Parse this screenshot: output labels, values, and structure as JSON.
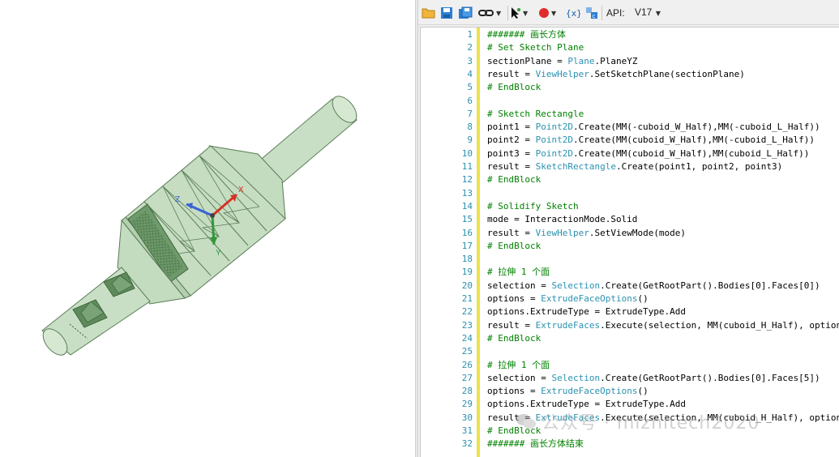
{
  "toolbar": {
    "items": [
      {
        "name": "open-folder"
      },
      {
        "name": "save"
      },
      {
        "name": "save-as"
      },
      {
        "name": "link"
      },
      {
        "name": "select-pointer"
      },
      {
        "name": "record"
      },
      {
        "name": "parameter"
      },
      {
        "name": "convert"
      }
    ],
    "api_label": "API:",
    "api_version": "V17"
  },
  "editor": {
    "lines": [
      {
        "n": "1",
        "segs": [
          {
            "t": "####### 画长方体",
            "c": "comment"
          }
        ]
      },
      {
        "n": "2",
        "segs": [
          {
            "t": "# Set Sketch Plane",
            "c": "comment"
          }
        ]
      },
      {
        "n": "3",
        "segs": [
          {
            "t": "sectionPlane = ",
            "c": "plain"
          },
          {
            "t": "Plane",
            "c": "class"
          },
          {
            "t": ".PlaneYZ",
            "c": "plain"
          }
        ]
      },
      {
        "n": "4",
        "segs": [
          {
            "t": "result = ",
            "c": "plain"
          },
          {
            "t": "ViewHelper",
            "c": "class"
          },
          {
            "t": ".SetSketchPlane(sectionPlane)",
            "c": "plain"
          }
        ]
      },
      {
        "n": "5",
        "segs": [
          {
            "t": "# EndBlock",
            "c": "comment"
          }
        ]
      },
      {
        "n": "6",
        "segs": []
      },
      {
        "n": "7",
        "segs": [
          {
            "t": "# Sketch Rectangle",
            "c": "comment"
          }
        ]
      },
      {
        "n": "8",
        "segs": [
          {
            "t": "point1 = ",
            "c": "plain"
          },
          {
            "t": "Point2D",
            "c": "class"
          },
          {
            "t": ".Create(MM(-cuboid_W_Half),MM(-cuboid_L_Half))",
            "c": "plain"
          }
        ]
      },
      {
        "n": "9",
        "segs": [
          {
            "t": "point2 = ",
            "c": "plain"
          },
          {
            "t": "Point2D",
            "c": "class"
          },
          {
            "t": ".Create(MM(cuboid_W_Half),MM(-cuboid_L_Half))",
            "c": "plain"
          }
        ]
      },
      {
        "n": "10",
        "segs": [
          {
            "t": "point3 = ",
            "c": "plain"
          },
          {
            "t": "Point2D",
            "c": "class"
          },
          {
            "t": ".Create(MM(cuboid_W_Half),MM(cuboid_L_Half))",
            "c": "plain"
          }
        ]
      },
      {
        "n": "11",
        "segs": [
          {
            "t": "result = ",
            "c": "plain"
          },
          {
            "t": "SketchRectangle",
            "c": "class"
          },
          {
            "t": ".Create(point1, point2, point3)",
            "c": "plain"
          }
        ]
      },
      {
        "n": "12",
        "segs": [
          {
            "t": "# EndBlock",
            "c": "comment"
          }
        ]
      },
      {
        "n": "13",
        "segs": []
      },
      {
        "n": "14",
        "segs": [
          {
            "t": "# Solidify Sketch",
            "c": "comment"
          }
        ]
      },
      {
        "n": "15",
        "segs": [
          {
            "t": "mode = InteractionMode.Solid",
            "c": "plain"
          }
        ]
      },
      {
        "n": "16",
        "segs": [
          {
            "t": "result = ",
            "c": "plain"
          },
          {
            "t": "ViewHelper",
            "c": "class"
          },
          {
            "t": ".SetViewMode(mode)",
            "c": "plain"
          }
        ]
      },
      {
        "n": "17",
        "segs": [
          {
            "t": "# EndBlock",
            "c": "comment"
          }
        ]
      },
      {
        "n": "18",
        "segs": []
      },
      {
        "n": "19",
        "segs": [
          {
            "t": "# 拉伸 1 个面",
            "c": "comment"
          }
        ]
      },
      {
        "n": "20",
        "segs": [
          {
            "t": "selection = ",
            "c": "plain"
          },
          {
            "t": "Selection",
            "c": "class"
          },
          {
            "t": ".Create(GetRootPart().Bodies[0].Faces[0])",
            "c": "plain"
          }
        ]
      },
      {
        "n": "21",
        "segs": [
          {
            "t": "options = ",
            "c": "plain"
          },
          {
            "t": "ExtrudeFaceOptions",
            "c": "class"
          },
          {
            "t": "()",
            "c": "plain"
          }
        ]
      },
      {
        "n": "22",
        "segs": [
          {
            "t": "options.ExtrudeType = ExtrudeType.Add",
            "c": "plain"
          }
        ]
      },
      {
        "n": "23",
        "segs": [
          {
            "t": "result = ",
            "c": "plain"
          },
          {
            "t": "ExtrudeFaces",
            "c": "class"
          },
          {
            "t": ".Execute(selection, MM(cuboid_H_Half), options)",
            "c": "plain"
          }
        ]
      },
      {
        "n": "24",
        "segs": [
          {
            "t": "# EndBlock",
            "c": "comment"
          }
        ]
      },
      {
        "n": "25",
        "segs": []
      },
      {
        "n": "26",
        "segs": [
          {
            "t": "# 拉伸 1 个面",
            "c": "comment"
          }
        ]
      },
      {
        "n": "27",
        "segs": [
          {
            "t": "selection = ",
            "c": "plain"
          },
          {
            "t": "Selection",
            "c": "class"
          },
          {
            "t": ".Create(GetRootPart().Bodies[0].Faces[5])",
            "c": "plain"
          }
        ]
      },
      {
        "n": "28",
        "segs": [
          {
            "t": "options = ",
            "c": "plain"
          },
          {
            "t": "ExtrudeFaceOptions",
            "c": "class"
          },
          {
            "t": "()",
            "c": "plain"
          }
        ]
      },
      {
        "n": "29",
        "segs": [
          {
            "t": "options.ExtrudeType = ExtrudeType.Add",
            "c": "plain"
          }
        ]
      },
      {
        "n": "30",
        "segs": [
          {
            "t": "result = ",
            "c": "plain"
          },
          {
            "t": "ExtrudeFaces",
            "c": "class"
          },
          {
            "t": ".Execute(selection, MM(cuboid_H_Half), options)",
            "c": "plain"
          }
        ]
      },
      {
        "n": "31",
        "segs": [
          {
            "t": "# EndBlock",
            "c": "comment"
          }
        ]
      },
      {
        "n": "32",
        "segs": [
          {
            "t": "####### 画长方体结束",
            "c": "comment"
          }
        ]
      }
    ]
  },
  "viewport": {
    "triad": {
      "x_label": "X",
      "y_label": "Y",
      "z_label": "Z"
    },
    "model_color": "#c9dfc5",
    "edge_color": "#5a7d57"
  },
  "watermark": {
    "text": "公众号 · mizhitech2020"
  },
  "colors": {
    "comment": "#008000",
    "class": "#2b91af",
    "plain": "#000000",
    "line_number": "#2b91af",
    "change_bar": "#ede14a"
  }
}
